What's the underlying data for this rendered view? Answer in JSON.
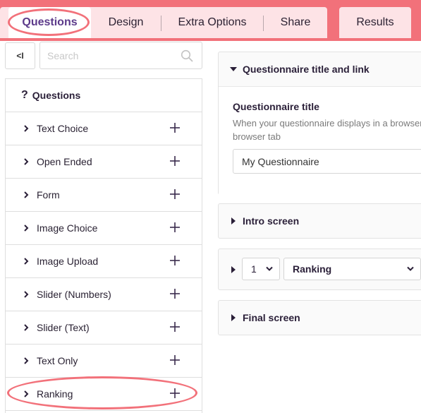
{
  "tabs": {
    "questions": "Questions",
    "design": "Design",
    "extra_options": "Extra Options",
    "share": "Share",
    "results": "Results"
  },
  "sidebar": {
    "collapse_label": "<I",
    "search_placeholder": "Search",
    "header": "Questions",
    "header_icon": "question-mark-icon",
    "items": [
      {
        "label": "Text Choice"
      },
      {
        "label": "Open Ended"
      },
      {
        "label": "Form"
      },
      {
        "label": "Image Choice"
      },
      {
        "label": "Image Upload"
      },
      {
        "label": "Slider (Numbers)"
      },
      {
        "label": "Slider (Text)"
      },
      {
        "label": "Text Only"
      },
      {
        "label": "Ranking"
      }
    ]
  },
  "main": {
    "title_panel": {
      "heading": "Questionnaire title and link",
      "field_label": "Questionnaire title",
      "help_line1": "When your questionnaire displays in a browser",
      "help_line2": "browser tab",
      "value": "My Questionnaire"
    },
    "intro_heading": "Intro screen",
    "question_row": {
      "number": "1",
      "type": "Ranking"
    },
    "final_heading": "Final screen"
  },
  "colors": {
    "top_bar": "#f2717a",
    "tab_bg": "#fde3e6",
    "active_tab_text": "#5c3a8a",
    "highlight": "#f2717a"
  }
}
